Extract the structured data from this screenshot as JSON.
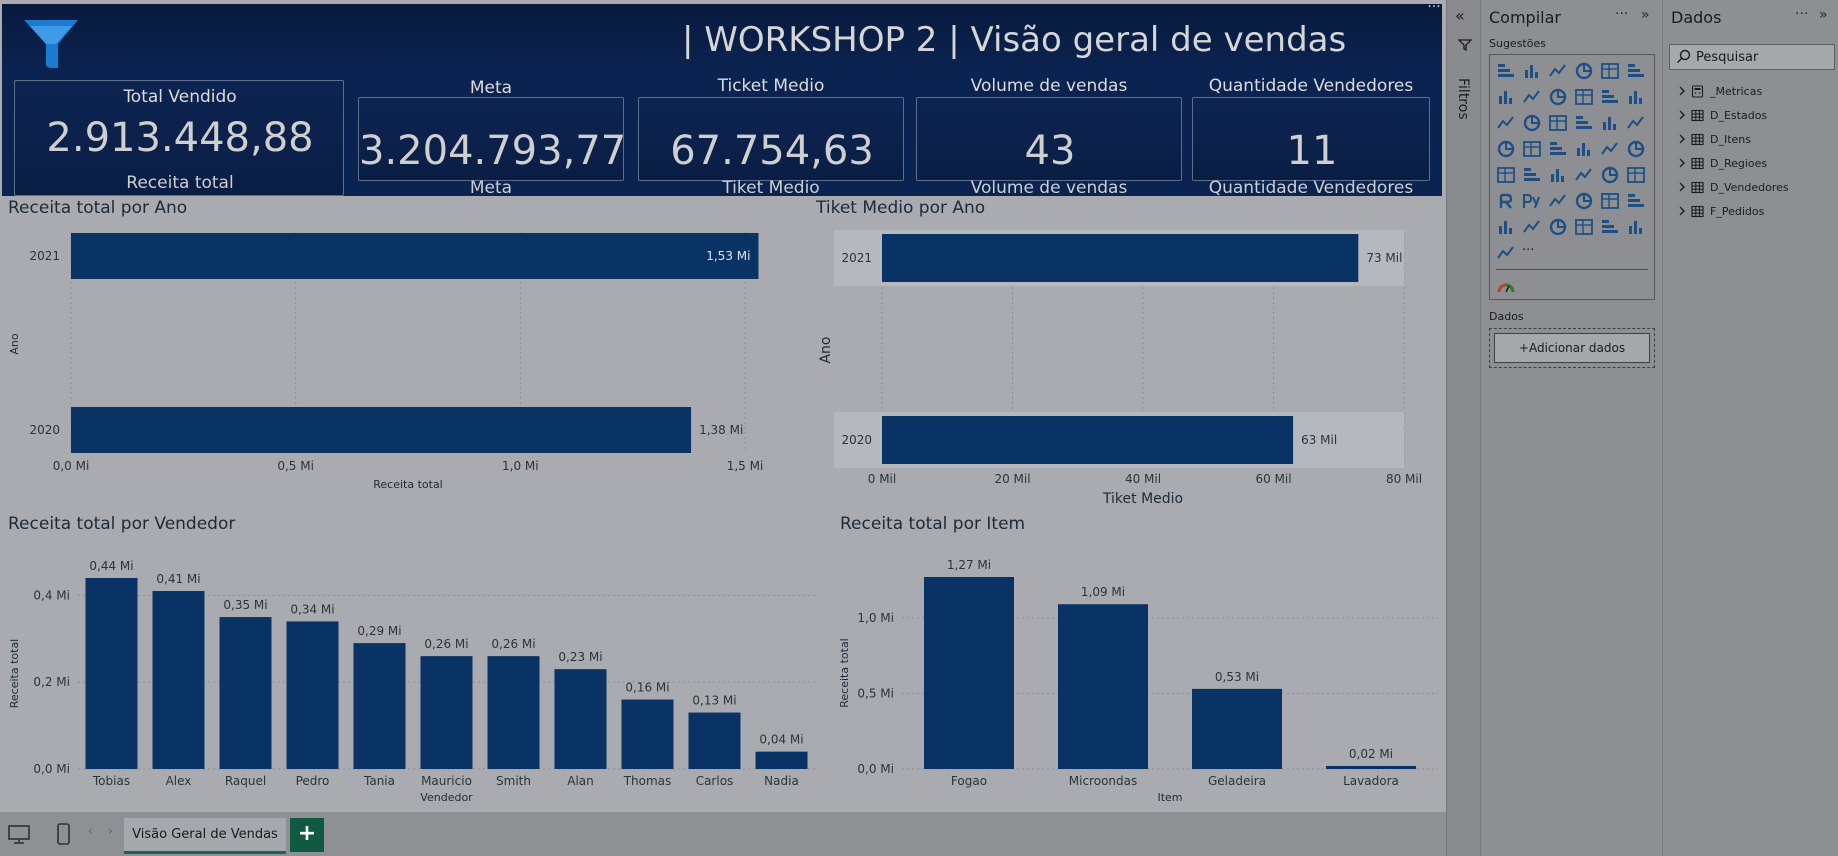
{
  "report": {
    "title": "| WORKSHOP 2 | Visão geral de vendas",
    "canvas_more": "···"
  },
  "kpis": [
    {
      "title": "Total Vendido",
      "value": "2.913.448,88",
      "sub": "Receita total"
    },
    {
      "title": "Meta",
      "value": "3.204.793,77",
      "sub": "Meta"
    },
    {
      "title": "Ticket Medio",
      "value": "67.754,63",
      "sub": "Tiket Medio"
    },
    {
      "title": "Volume de vendas",
      "value": "43",
      "sub": "Volume de vendas"
    },
    {
      "title": "Quantidade Vendedores",
      "value": "11",
      "sub": "Quantidade Vendedores"
    }
  ],
  "charts": {
    "receita_ano": {
      "title": "Receita total por Ano"
    },
    "ticket_ano": {
      "title": "Tiket Medio por Ano"
    },
    "receita_vendedor": {
      "title": "Receita total por Vendedor"
    },
    "receita_item": {
      "title": "Receita total por Item"
    }
  },
  "chart_data": [
    {
      "type": "bar",
      "orientation": "horizontal",
      "title": "Receita total por Ano",
      "categories": [
        "2021",
        "2020"
      ],
      "values": [
        1.53,
        1.38
      ],
      "data_labels": [
        "1,53 Mi",
        "1,38 Mi"
      ],
      "xlabel": "Receita total",
      "ylabel": "Ano",
      "xlim": [
        0,
        1.5
      ],
      "x_ticks": [
        "0,0 Mi",
        "0,5 Mi",
        "1,0 Mi",
        "1,5 Mi"
      ],
      "grid": true,
      "color": "#0a3365"
    },
    {
      "type": "bar",
      "orientation": "horizontal",
      "title": "Tiket Medio por Ano",
      "categories": [
        "2021",
        "2020"
      ],
      "values": [
        73,
        63
      ],
      "data_labels": [
        "73 Mil",
        "63 Mil"
      ],
      "xlabel": "Tiket Medio",
      "ylabel": "Ano",
      "xlim": [
        0,
        80
      ],
      "x_ticks": [
        "0 Mil",
        "20 Mil",
        "40 Mil",
        "60 Mil",
        "80 Mil"
      ],
      "grid": true,
      "color": "#0a3365"
    },
    {
      "type": "bar",
      "orientation": "vertical",
      "title": "Receita total por Vendedor",
      "categories": [
        "Tobias",
        "Alex",
        "Raquel",
        "Pedro",
        "Tania",
        "Mauricio",
        "Smith",
        "Alan",
        "Thomas",
        "Carlos",
        "Nadia"
      ],
      "values": [
        0.44,
        0.41,
        0.35,
        0.34,
        0.29,
        0.26,
        0.26,
        0.23,
        0.16,
        0.13,
        0.04
      ],
      "data_labels": [
        "0,44 Mi",
        "0,41 Mi",
        "0,35 Mi",
        "0,34 Mi",
        "0,29 Mi",
        "0,26 Mi",
        "0,26 Mi",
        "0,23 Mi",
        "0,16 Mi",
        "0,13 Mi",
        "0,04 Mi"
      ],
      "xlabel": "Vendedor",
      "ylabel": "Receita total",
      "ylim": [
        0,
        0.44
      ],
      "y_ticks": [
        "0,0 Mi",
        "0,2 Mi",
        "0,4 Mi"
      ],
      "y_tick_values": [
        0,
        0.2,
        0.4
      ],
      "grid": true,
      "color": "#0a3365"
    },
    {
      "type": "bar",
      "orientation": "vertical",
      "title": "Receita total por Item",
      "categories": [
        "Fogao",
        "Microondas",
        "Geladeira",
        "Lavadora"
      ],
      "values": [
        1.27,
        1.09,
        0.53,
        0.02
      ],
      "data_labels": [
        "1,27 Mi",
        "1,09 Mi",
        "0,53 Mi",
        "0,02 Mi"
      ],
      "xlabel": "Item",
      "ylabel": "Receita total",
      "ylim": [
        0,
        1.27
      ],
      "y_ticks": [
        "0,0 Mi",
        "0,5 Mi",
        "1,0 Mi"
      ],
      "y_tick_values": [
        0,
        0.5,
        1.0
      ],
      "grid": true,
      "color": "#0a3365"
    }
  ],
  "filters": {
    "label": "Filtros",
    "collapse": "«"
  },
  "build": {
    "title": "Compilar",
    "more": "···",
    "expand": "»",
    "suggestions_label": "Sugestões",
    "data_label": "Dados",
    "add_data": "+Adicionar dados",
    "more_visuals": "···"
  },
  "data_pane": {
    "title": "Dados",
    "more": "···",
    "expand": "»",
    "search_placeholder": "Pesquisar",
    "tables": [
      "_Metricas",
      "D_Estados",
      "D_Itens",
      "D_Regioes",
      "D_Vendedores",
      "F_Pedidos"
    ]
  },
  "tabs": {
    "page": "Visão Geral de Vendas",
    "add": "+"
  },
  "colors": {
    "bar": "#0a3365",
    "header": "#0b2350",
    "accent": "#0e6b4f"
  }
}
